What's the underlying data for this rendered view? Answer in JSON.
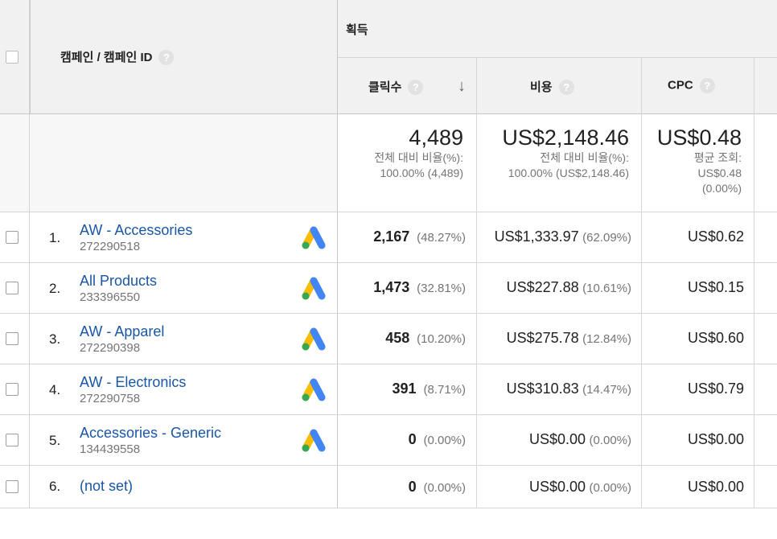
{
  "header": {
    "group_label": "획득",
    "campaign_col": "캠페인 / 캠페인 ID",
    "clicks_col": "클릭수",
    "cost_col": "비용",
    "cpc_col": "CPC",
    "help_glyph": "?",
    "sort_arrow": "↓"
  },
  "totals": {
    "clicks": {
      "value": "4,489",
      "line1": "전체 대비 비율(%):",
      "line2": "100.00% (4,489)"
    },
    "cost": {
      "value": "US$2,148.46",
      "line1": "전체 대비 비율(%):",
      "line2": "100.00% (US$2,148.46)"
    },
    "cpc": {
      "value": "US$0.48",
      "line1": "평균 조회:",
      "line2": "US$0.48",
      "line3": "(0.00%)"
    }
  },
  "rows": [
    {
      "num": "1.",
      "name": "AW - Accessories",
      "id": "272290518",
      "clicks": "2,167",
      "clicks_pct": "(48.27%)",
      "cost": "US$1,333.97",
      "cost_pct": "(62.09%)",
      "cpc": "US$0.62",
      "icon": "google-ads-icon"
    },
    {
      "num": "2.",
      "name": "All Products",
      "id": "233396550",
      "clicks": "1,473",
      "clicks_pct": "(32.81%)",
      "cost": "US$227.88",
      "cost_pct": "(10.61%)",
      "cpc": "US$0.15",
      "icon": "google-ads-icon"
    },
    {
      "num": "3.",
      "name": "AW - Apparel",
      "id": "272290398",
      "clicks": "458",
      "clicks_pct": "(10.20%)",
      "cost": "US$275.78",
      "cost_pct": "(12.84%)",
      "cpc": "US$0.60",
      "icon": "google-ads-icon"
    },
    {
      "num": "4.",
      "name": "AW - Electronics",
      "id": "272290758",
      "clicks": "391",
      "clicks_pct": "(8.71%)",
      "cost": "US$310.83",
      "cost_pct": "(14.47%)",
      "cpc": "US$0.79",
      "icon": "google-ads-icon"
    },
    {
      "num": "5.",
      "name": "Accessories - Generic",
      "id": "134439558",
      "clicks": "0",
      "clicks_pct": "(0.00%)",
      "cost": "US$0.00",
      "cost_pct": "(0.00%)",
      "cpc": "US$0.00",
      "icon": "google-ads-icon"
    },
    {
      "num": "6.",
      "name": "(not set)",
      "id": "",
      "clicks": "0",
      "clicks_pct": "(0.00%)",
      "cost": "US$0.00",
      "cost_pct": "(0.00%)",
      "cpc": "US$0.00",
      "icon": ""
    }
  ],
  "colors": {
    "link": "#1a56a6",
    "header_bg": "#f1f1f1",
    "grid": "#d6d6d6",
    "ads_blue": "#4285f4",
    "ads_yellow": "#fbbc04",
    "ads_green": "#34a853"
  }
}
